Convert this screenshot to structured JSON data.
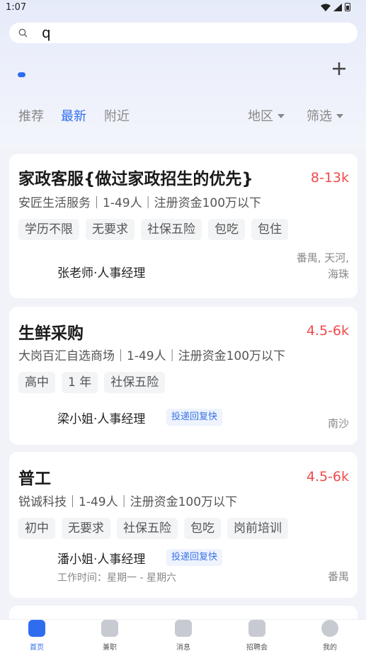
{
  "status": {
    "time": "1:07"
  },
  "search": {
    "query": "q"
  },
  "filters": {
    "tabs": [
      "推荐",
      "最新",
      "附近"
    ],
    "active_tab": "最新",
    "region": "地区",
    "filter": "筛选"
  },
  "jobs": [
    {
      "title": "家政客服{做过家政招生的优先}",
      "salary": "8-13k",
      "company": "安匠生活服务｜1-49人｜注册资金100万以下",
      "tags": [
        "学历不限",
        "无要求",
        "社保五险",
        "包吃",
        "包住"
      ],
      "contact": "张老师·人事经理",
      "location_line1": "番禺, 天河,",
      "location_line2": "海珠"
    },
    {
      "title": "生鲜采购",
      "salary": "4.5-6k",
      "company": "大岗百汇自选商场｜1-49人｜注册资金100万以下",
      "tags": [
        "高中",
        "1 年",
        "社保五险"
      ],
      "contact": "梁小姐·人事经理",
      "badge": "投递回复快",
      "location": "南沙"
    },
    {
      "title": "普工",
      "salary": "4.5-6k",
      "company": "锐诚科技｜1-49人｜注册资金100万以下",
      "tags": [
        "初中",
        "无要求",
        "社保五险",
        "包吃",
        "岗前培训"
      ],
      "contact": "潘小姐·人事经理",
      "badge": "投递回复快",
      "worktime": "工作时间：星期一 - 星期六",
      "location": "番禺"
    }
  ],
  "bottom_nav": [
    {
      "label": "首页",
      "icon": "home-icon",
      "active": true
    },
    {
      "label": "兼职",
      "icon": "clock-icon",
      "active": false
    },
    {
      "label": "消息",
      "icon": "message-icon",
      "active": false
    },
    {
      "label": "招聘会",
      "icon": "job-fair-icon",
      "active": false
    },
    {
      "label": "我的",
      "icon": "profile-icon",
      "active": false
    }
  ],
  "colors": {
    "accent": "#2f6df0",
    "salary": "#ef4b4b"
  }
}
